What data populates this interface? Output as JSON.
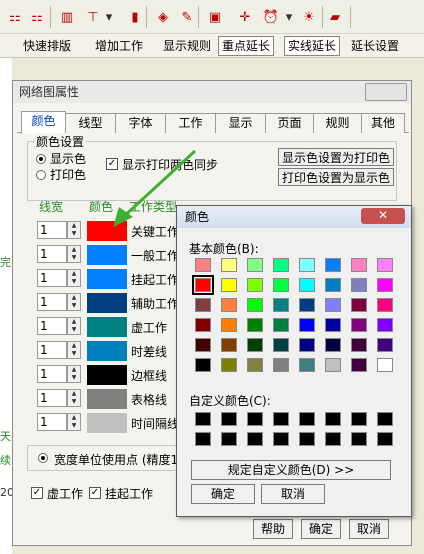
{
  "toolbar": {
    "icons": [
      "hierarchy-icon",
      "outdent-icon",
      "chart-icon",
      "tree-icon",
      "dropdown-icon",
      "books-icon",
      "eraser-icon",
      "pencil-icon",
      "monitor-icon",
      "cross-icon",
      "alarm-icon",
      "dropdown-icon",
      "lightbulb-icon",
      "lock-icon"
    ],
    "items": [
      "快速排版",
      "增加工作",
      "显示规则",
      "重点延长",
      "实线延长",
      "延长设置"
    ]
  },
  "background": {
    "texts": [
      "完",
      "天",
      "续",
      "20"
    ]
  },
  "dialog": {
    "title": "网络图属性",
    "tabs": [
      "颜色",
      "线型",
      "字体",
      "工作",
      "显示",
      "页面",
      "规则",
      "其他"
    ],
    "group_title": "颜色设置",
    "radio_display": "显示色",
    "radio_print": "打印色",
    "sync_label": "显示打印两色同步",
    "btn_display_to_print": "显示色设置为打印色",
    "btn_print_to_display": "打印色设置为显示色",
    "col_headers": [
      "线宽",
      "颜色",
      "工作类型"
    ],
    "rows": [
      {
        "width": "1",
        "color": "#ff0000",
        "label": "关键工作"
      },
      {
        "width": "1",
        "color": "#0080ff",
        "label": "一般工作"
      },
      {
        "width": "1",
        "color": "#0080ff",
        "label": "挂起工作"
      },
      {
        "width": "1",
        "color": "#004080",
        "label": "辅助工作"
      },
      {
        "width": "1",
        "color": "#008080",
        "label": "虚工作"
      },
      {
        "width": "1",
        "color": "#0080c0",
        "label": "时差线"
      },
      {
        "width": "1",
        "color": "#000000",
        "label": "边框线"
      },
      {
        "width": "1",
        "color": "#808080",
        "label": "表格线"
      },
      {
        "width": "1",
        "color": "#c0c0c0",
        "label": "时间隔线"
      }
    ],
    "unit_label": "宽度单位使用点 (精度1",
    "bottom_checks": [
      "虚工作",
      "挂起工作"
    ],
    "btn_help": "帮助",
    "btn_ok": "确定",
    "btn_cancel": "取消"
  },
  "color_picker": {
    "title": "颜色",
    "close": "✕",
    "basic_label": "基本颜色(B):",
    "custom_label": "自定义颜色(C):",
    "define_btn": "规定自定义颜色(D) >>",
    "ok": "确定",
    "cancel": "取消",
    "basic_colors": [
      "#ff8080",
      "#ffff80",
      "#80ff80",
      "#00ff80",
      "#80ffff",
      "#0080ff",
      "#ff80c0",
      "#ff80ff",
      "#ff0000",
      "#ffff00",
      "#80ff00",
      "#00ff40",
      "#00ffff",
      "#0080c0",
      "#8080c0",
      "#ff00ff",
      "#804040",
      "#ff8040",
      "#00ff00",
      "#008080",
      "#004080",
      "#8080ff",
      "#800040",
      "#ff0080",
      "#800000",
      "#ff8000",
      "#008000",
      "#008040",
      "#0000ff",
      "#0000a0",
      "#800080",
      "#8000ff",
      "#400000",
      "#804000",
      "#004000",
      "#004040",
      "#000080",
      "#000040",
      "#400040",
      "#400080",
      "#000000",
      "#808000",
      "#808040",
      "#808080",
      "#408080",
      "#c0c0c0",
      "#400040",
      "#ffffff"
    ],
    "selected_index": 8
  }
}
